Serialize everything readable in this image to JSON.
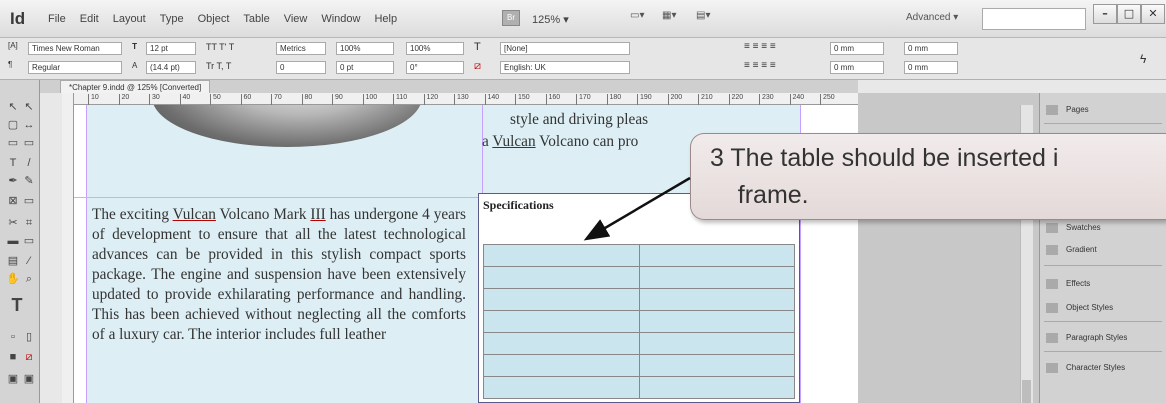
{
  "menubar": {
    "app_logo": "Id",
    "menus": [
      "File",
      "Edit",
      "Layout",
      "Type",
      "Object",
      "Table",
      "View",
      "Window",
      "Help"
    ],
    "bridge": "Br",
    "zoom": "125% ▾",
    "workspace": "Advanced ▾",
    "window_buttons": [
      "–",
      "□",
      "✕"
    ]
  },
  "control_panel": {
    "font_family": "Times New Roman",
    "font_style": "Regular",
    "font_size": "12 pt",
    "leading": "(14.4 pt)",
    "kerning": "Metrics",
    "tracking": "0",
    "vscale": "100%",
    "hscale": "100%",
    "baseline": "0 pt",
    "skew": "0°",
    "char_style": "[None]",
    "language": "English: UK",
    "indent1": "0 mm",
    "indent2": "0 mm",
    "space1": "0 mm",
    "space2": "0 mm"
  },
  "document": {
    "tab_title": "*Chapter 9.indd @ 125% [Converted]",
    "ruler_marks": [
      "10",
      "20",
      "30",
      "40",
      "50",
      "60",
      "70",
      "80",
      "90",
      "100",
      "110",
      "120",
      "130",
      "140",
      "150",
      "160",
      "170",
      "180",
      "190",
      "200",
      "210",
      "220",
      "230",
      "240",
      "250"
    ]
  },
  "page": {
    "right_top_line1": "style and driving pleas",
    "right_top_line2": "a Vulcan Volcano can pro",
    "specifications_heading": "Specifications",
    "body_text": "The exciting Vulcan Volcano Mark III has undergone 4 years of development to ensure that all the latest technological advances can be provided in this stylish compact sports package. The engine and suspension have been extensively updated to provide exhilarating performance and handling.  This has been achieved without neglecting all the comforts of a luxury car. The interior includes full leather"
  },
  "callout": {
    "text_line1": "3  The table should be inserted i",
    "text_line2": "    frame."
  },
  "panels": {
    "items": [
      "Pages",
      "Swatches",
      "Gradient",
      "Effects",
      "Object Styles",
      "Paragraph Styles",
      "Character Styles"
    ]
  },
  "colors": {
    "column_fill": "#ddeff5",
    "table_cell": "#cbe5ef",
    "callout_bg": "#ece3e3"
  }
}
